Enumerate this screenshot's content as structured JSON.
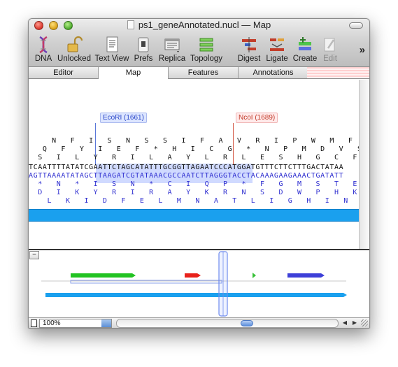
{
  "window": {
    "title": "ps1_geneAnnotated.nucl — Map"
  },
  "toolbar": {
    "items": [
      {
        "label": "DNA",
        "icon": "dna-helix-icon"
      },
      {
        "label": "Unlocked",
        "icon": "unlocked-padlock-icon"
      },
      {
        "label": "Text View",
        "icon": "text-document-icon"
      },
      {
        "label": "Prefs",
        "icon": "preferences-switch-icon"
      },
      {
        "label": "Replica",
        "icon": "replica-window-icon"
      },
      {
        "label": "Topology",
        "icon": "topology-bars-icon"
      },
      {
        "label": "Digest",
        "icon": "digest-scissors-icon"
      },
      {
        "label": "Ligate",
        "icon": "ligate-icon"
      },
      {
        "label": "Create",
        "icon": "create-primer-icon"
      },
      {
        "label": "Edit",
        "icon": "edit-pencil-icon"
      }
    ],
    "overflow": "»"
  },
  "tabs": [
    "Editor",
    "Map",
    "Features",
    "Annotations"
  ],
  "sequence": {
    "sites": {
      "ecori": "EcoRI (1661)",
      "ncoi": "NcoI (1689)"
    },
    "frame_rows": [
      "     N   F   I   S   N   S   S   I   F   A   V   R   I   P   W   M   F   L   L   *   L   *",
      "   Q   F   Y   I   E   F   *   H   I   C   G   *   N   P   M   D   V   S   S   L   T   I",
      "  S   I   L   Y   R   I   L   A   Y   L   R   L   E   S   H   G   C   F   F   D   Y   N"
    ],
    "dna_top": "TCAATTTTATATCGAATTCTAGCATATTTGCGGTTAGAATCCCATGGATGTTTCTTCTTTGACTATAA",
    "dna_bottom": "AGTTAAAATATAGCTTAAGATCGTATAAACGCCAATCTTAGGGTACCTACAAAGAAGAAACTGATATT",
    "reverse_rows": [
      "  *   N   *   I   S   N   *   C   I   Q   P   *   F   G   M   S   T   E   E   K   V   I   V",
      "  D   I   K   Y   R   I   R   A   Y   K   R   N   S   D   W   P   H   K   K   S   *   L",
      "    L   K   I   D   F   E   L   M   N   A   T   L   I   G   H   I   N   R   R   Q   S   Y"
    ]
  },
  "map": {
    "minus_label": "−"
  },
  "statusbar": {
    "zoom": "100%"
  },
  "colors": {
    "feature_bar": "#1aa0ee",
    "green_feature": "#22c322",
    "red_feature": "#e8211b",
    "blue_feature": "#3d3fd8",
    "selection": "#7d93ff"
  }
}
